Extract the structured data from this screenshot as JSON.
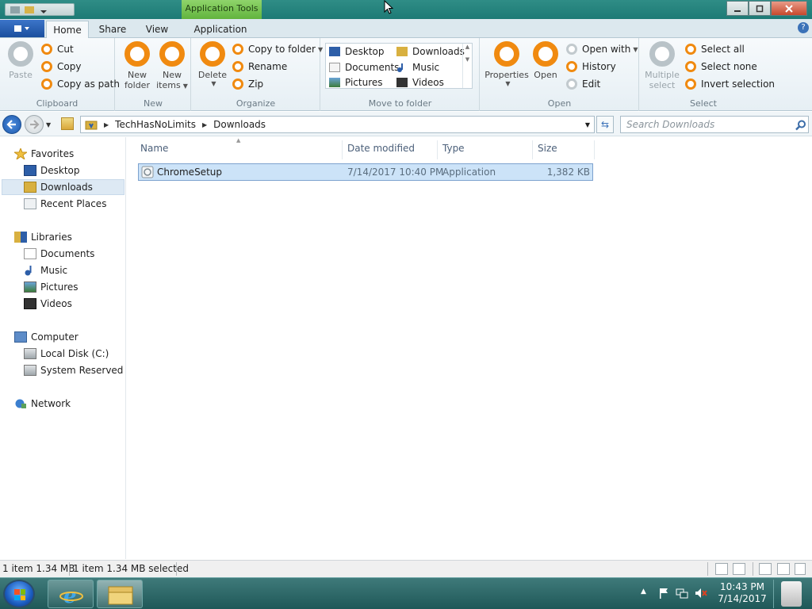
{
  "titlebar": {
    "context_tab": "Application Tools"
  },
  "ribbon_tabs": {
    "file_icon": "file-menu-icon",
    "home": "Home",
    "share": "Share",
    "view": "View",
    "application": "Application"
  },
  "ribbon": {
    "clipboard": {
      "paste": "Paste",
      "cut": "Cut",
      "copy": "Copy",
      "copy_path": "Copy as path",
      "label": "Clipboard"
    },
    "new": {
      "new_folder_1": "New",
      "new_folder_2": "folder",
      "new_items_1": "New",
      "new_items_2": "items",
      "label": "New"
    },
    "organize": {
      "delete": "Delete",
      "copy_to": "Copy to folder",
      "rename": "Rename",
      "zip": "Zip",
      "label": "Organize"
    },
    "move_to": {
      "items": [
        "Desktop",
        "Downloads",
        "Documents",
        "Music",
        "Pictures",
        "Videos"
      ],
      "label": "Move to folder"
    },
    "open": {
      "properties": "Properties",
      "open": "Open",
      "open_with": "Open with",
      "history": "History",
      "edit": "Edit",
      "label": "Open"
    },
    "select": {
      "multiple_1": "Multiple",
      "multiple_2": "select",
      "select_all": "Select all",
      "select_none": "Select none",
      "invert": "Invert selection",
      "label": "Select"
    }
  },
  "address": {
    "crumbs": [
      "TechHasNoLimits",
      "Downloads"
    ],
    "search_placeholder": "Search Downloads"
  },
  "nav": {
    "favorites": "Favorites",
    "desktop": "Desktop",
    "downloads": "Downloads",
    "recent": "Recent Places",
    "libraries": "Libraries",
    "documents": "Documents",
    "music": "Music",
    "pictures": "Pictures",
    "videos": "Videos",
    "computer": "Computer",
    "local_disk": "Local Disk (C:)",
    "system_reserved": "System Reserved (D:",
    "network": "Network"
  },
  "filelist": {
    "columns": {
      "name": "Name",
      "date": "Date modified",
      "type": "Type",
      "size": "Size"
    },
    "rows": [
      {
        "name": "ChromeSetup",
        "date": "7/14/2017 10:40 PM",
        "type": "Application",
        "size": "1,382 KB"
      }
    ]
  },
  "status": {
    "items": "1 item 1.34 MB",
    "selected": "1 item 1.34 MB selected"
  },
  "taskbar": {
    "time": "10:43 PM",
    "date": "7/14/2017"
  },
  "colors": {
    "accent_orange": "#f08a10",
    "selection": "#cce3f8",
    "taskbar": "#2f6a6a"
  }
}
